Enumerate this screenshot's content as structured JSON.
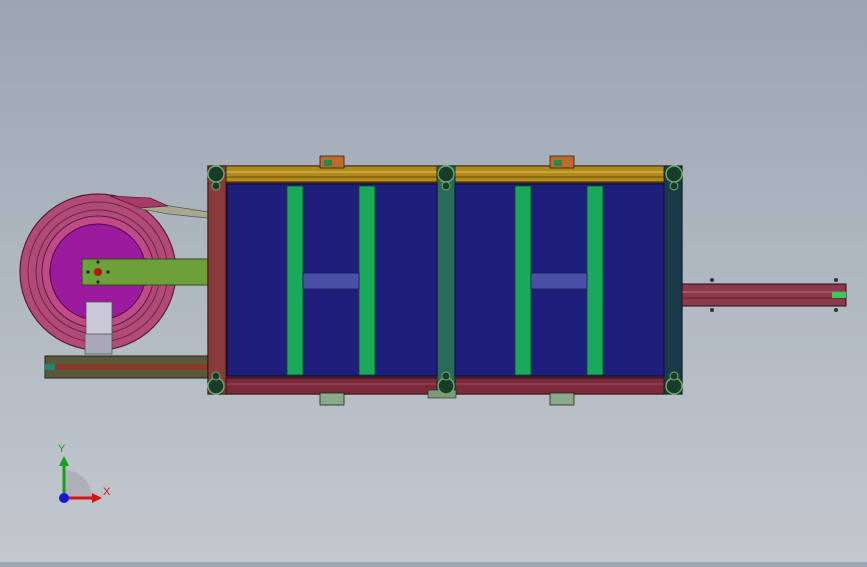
{
  "viewport": {
    "background_top": "#9ba6b2",
    "background_bottom": "#c3c8ce"
  },
  "model": {
    "frame_color": "#8a2a2a",
    "top_rail_color": "#b08a1a",
    "panel_color": "#1e1f7a",
    "slat_color": "#1aa85a",
    "crossbar_color": "#4a50a8",
    "reel_outer_color": "#a83a6a",
    "reel_hub_color": "#9a1a9a",
    "arm_color": "#6ea03a",
    "shaft_color": "#8a3a4a"
  },
  "triad": {
    "x_label": "X",
    "y_label": "Y",
    "x_color": "#d01818",
    "y_color": "#18a018",
    "z_color": "#1818d0",
    "icon": "coordinate-triad-icon"
  }
}
